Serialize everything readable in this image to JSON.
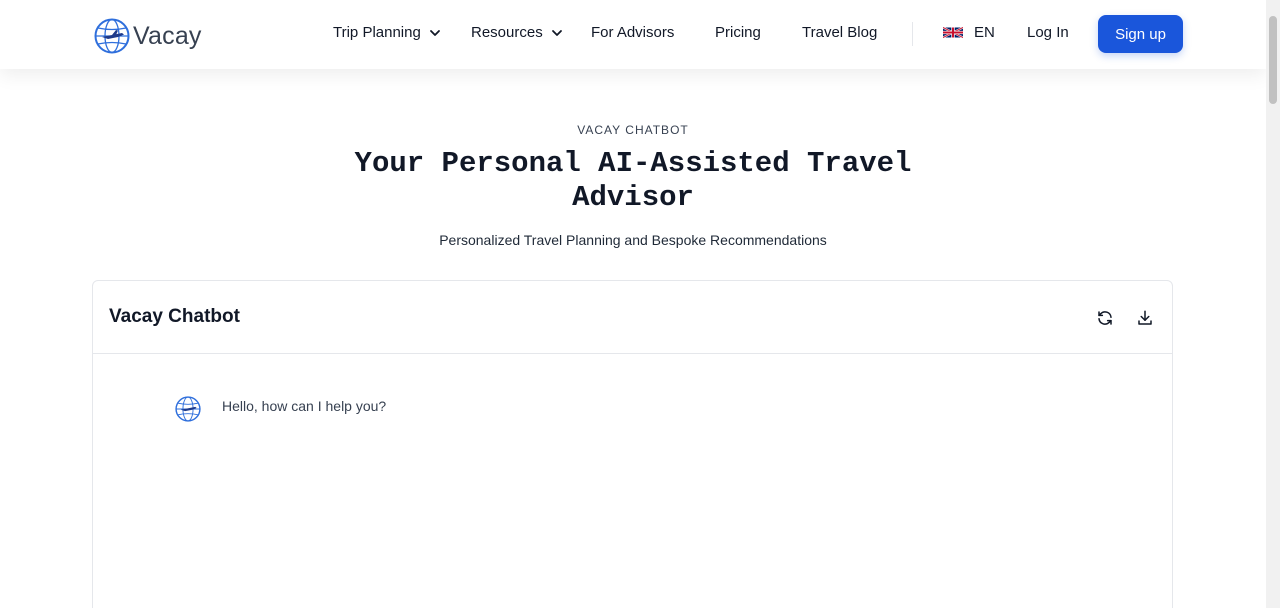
{
  "brand": {
    "name": "Vacay",
    "logo_icon": "globe-airplane-icon",
    "color": "#2f6fdc"
  },
  "nav": {
    "trip_planning": "Trip Planning",
    "resources": "Resources",
    "for_advisors": "For Advisors",
    "pricing": "Pricing",
    "travel_blog": "Travel Blog",
    "language": "EN",
    "login": "Log In",
    "signup": "Sign up"
  },
  "hero": {
    "eyebrow": "VACAY CHATBOT",
    "title_line1": "Your Personal AI-Assisted Travel",
    "title_line2": "Advisor",
    "subtitle": "Personalized Travel Planning and Bespoke Recommendations"
  },
  "chat": {
    "title": "Vacay Chatbot",
    "refresh_icon": "refresh-icon",
    "download_icon": "download-icon",
    "messages": [
      {
        "sender": "bot",
        "text": "Hello, how can I help you?"
      }
    ]
  },
  "colors": {
    "primary": "#1a56db",
    "text": "#111827",
    "border": "#e5e7eb"
  }
}
